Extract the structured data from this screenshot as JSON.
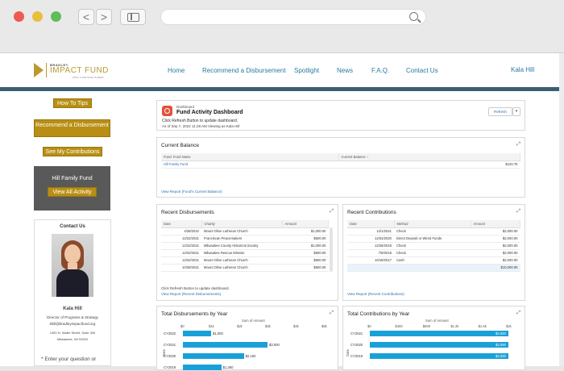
{
  "browser": {
    "back": "<",
    "forward": ">"
  },
  "site": {
    "logo": {
      "small": "BRADLEY",
      "big": "IMPACT FUND",
      "tag": "WITH YOUR GOAL IN MIND"
    },
    "nav": [
      "Home",
      "Recommend a Disbursement",
      "Spotlight",
      "News",
      "F.A.Q.",
      "Contact Us"
    ],
    "user": "Kala Hill"
  },
  "sidebar": {
    "how_to": "How To Tips",
    "recommend": "Recommend a Disbursement",
    "contributions": "See My Contributions",
    "family_fund": "Hill Family Fund",
    "view_all": "View All Activity",
    "contact": {
      "heading": "Contact Us",
      "name": "Kala Hill",
      "title": "Director of Programs & Strategy",
      "email": "khill@bradleyimpactfund.org",
      "address1": "1400 N. Water Street, Suite 300",
      "address2": "Milwaukee, WI 53202",
      "prompt": "* Enter your question or"
    }
  },
  "dashboard": {
    "breadcrumb": "Dashboard",
    "title": "Fund Activity Dashboard",
    "subtitle": "Click Refresh Button to update dashboard.",
    "asof": "As of Sep 7, 2022 11:28 AM Viewing as Kala Hill",
    "refresh": "Refresh"
  },
  "balance": {
    "title": "Current Balance",
    "columns": [
      "Fund: Fund Name",
      "Current Balance"
    ],
    "rows": [
      [
        "Hill Family Fund",
        "$120.75"
      ]
    ],
    "link": "View Report (Fund's Current Balance)"
  },
  "disbursements": {
    "title": "Recent Disbursements",
    "columns": [
      "Date",
      "Charity",
      "Amount"
    ],
    "rows": [
      [
        "4/28/2022",
        "Mount Olive Lutheran Church",
        "$1,000.00"
      ],
      [
        "12/22/2021",
        "Franciscan Peacemakers",
        "$500.00"
      ],
      [
        "12/22/2021",
        "Milwaukee County Historical Society",
        "$1,000.00"
      ],
      [
        "12/22/2021",
        "Milwaukee Rescue Mission",
        "$500.00"
      ],
      [
        "12/22/2021",
        "Mount Olive Lutheran Church",
        "$500.00"
      ],
      [
        "10/28/2021",
        "Mount Olive Lutheran Church",
        "$500.00"
      ]
    ],
    "note": "Click Refresh Button to update dashboard.",
    "link": "View Report (Recent Disbursements)"
  },
  "contributions": {
    "title": "Recent Contributions",
    "columns": [
      "Date",
      "Method",
      "Amount"
    ],
    "rows": [
      [
        "12/1/2021",
        "Check",
        "$2,000.00"
      ],
      [
        "12/24/2020",
        "Direct Deposit or Wired Funds",
        "$2,000.00"
      ],
      [
        "12/26/2019",
        "Check",
        "$2,000.00"
      ],
      [
        "7/9/2018",
        "Check",
        "$2,000.00"
      ],
      [
        "10/18/2017",
        "Cash",
        "$2,000.00"
      ]
    ],
    "total": "$10,000.00",
    "link": "View Report (Recent Contributions)"
  },
  "chart_data": [
    {
      "type": "bar",
      "title": "Total Disbursements by Year",
      "axis_title": "Sum of Amount",
      "ylabel": "Date",
      "ticks": [
        "$0",
        "$1k",
        "$2k",
        "$3k",
        "$4k",
        "$5k"
      ],
      "xlim": [
        0,
        5000
      ],
      "categories": [
        "CY2022",
        "CY2021",
        "CY2020",
        "CY2019"
      ],
      "values": [
        1000,
        3000,
        2160,
        1360
      ],
      "labels": [
        "$1,000",
        "$3,000",
        "$2,160",
        "$1,360"
      ]
    },
    {
      "type": "bar",
      "title": "Total Contributions by Year",
      "axis_title": "Sum of Amount",
      "ylabel": "Date",
      "ticks": [
        "$0",
        "$400",
        "$800",
        "$1.2k",
        "$1.6k",
        "$2k"
      ],
      "xlim": [
        0,
        2000
      ],
      "categories": [
        "CY2021",
        "CY2020",
        "CY2019"
      ],
      "values": [
        2000,
        2000,
        2000
      ],
      "labels": [
        "$2,000",
        "$2,000",
        "$2,000"
      ]
    }
  ]
}
